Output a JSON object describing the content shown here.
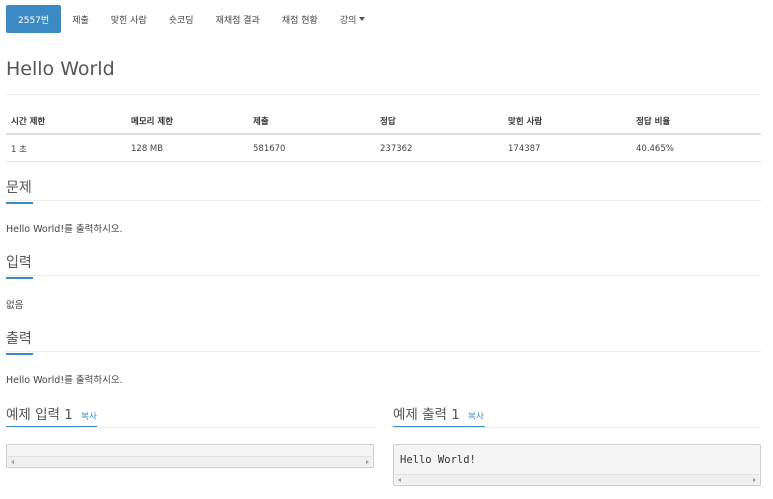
{
  "nav": {
    "items": [
      {
        "label": "2557번",
        "active": true
      },
      {
        "label": "제출"
      },
      {
        "label": "맞힌 사람"
      },
      {
        "label": "숏코딩"
      },
      {
        "label": "재채점 결과"
      },
      {
        "label": "채점 현황"
      },
      {
        "label": "강의"
      }
    ]
  },
  "problem": {
    "title": "Hello World",
    "table": {
      "headers": [
        "시간 제한",
        "메모리 제한",
        "제출",
        "정답",
        "맞힌 사람",
        "정답 비율"
      ],
      "row": [
        "1 초",
        "128 MB",
        "581670",
        "237362",
        "174387",
        "40.465%"
      ]
    }
  },
  "sections": {
    "problem": {
      "title": "문제",
      "body": "Hello World!를 출력하시오."
    },
    "input": {
      "title": "입력",
      "body": "없음"
    },
    "output": {
      "title": "출력",
      "body": "Hello World!를 출력하시오."
    }
  },
  "samples": {
    "input": {
      "title": "예제 입력",
      "number": "1",
      "copy": "복사",
      "content": ""
    },
    "output": {
      "title": "예제 출력",
      "number": "1",
      "copy": "복사",
      "content": "Hello World!"
    }
  },
  "colors": {
    "accent": "#3b8ac4"
  }
}
